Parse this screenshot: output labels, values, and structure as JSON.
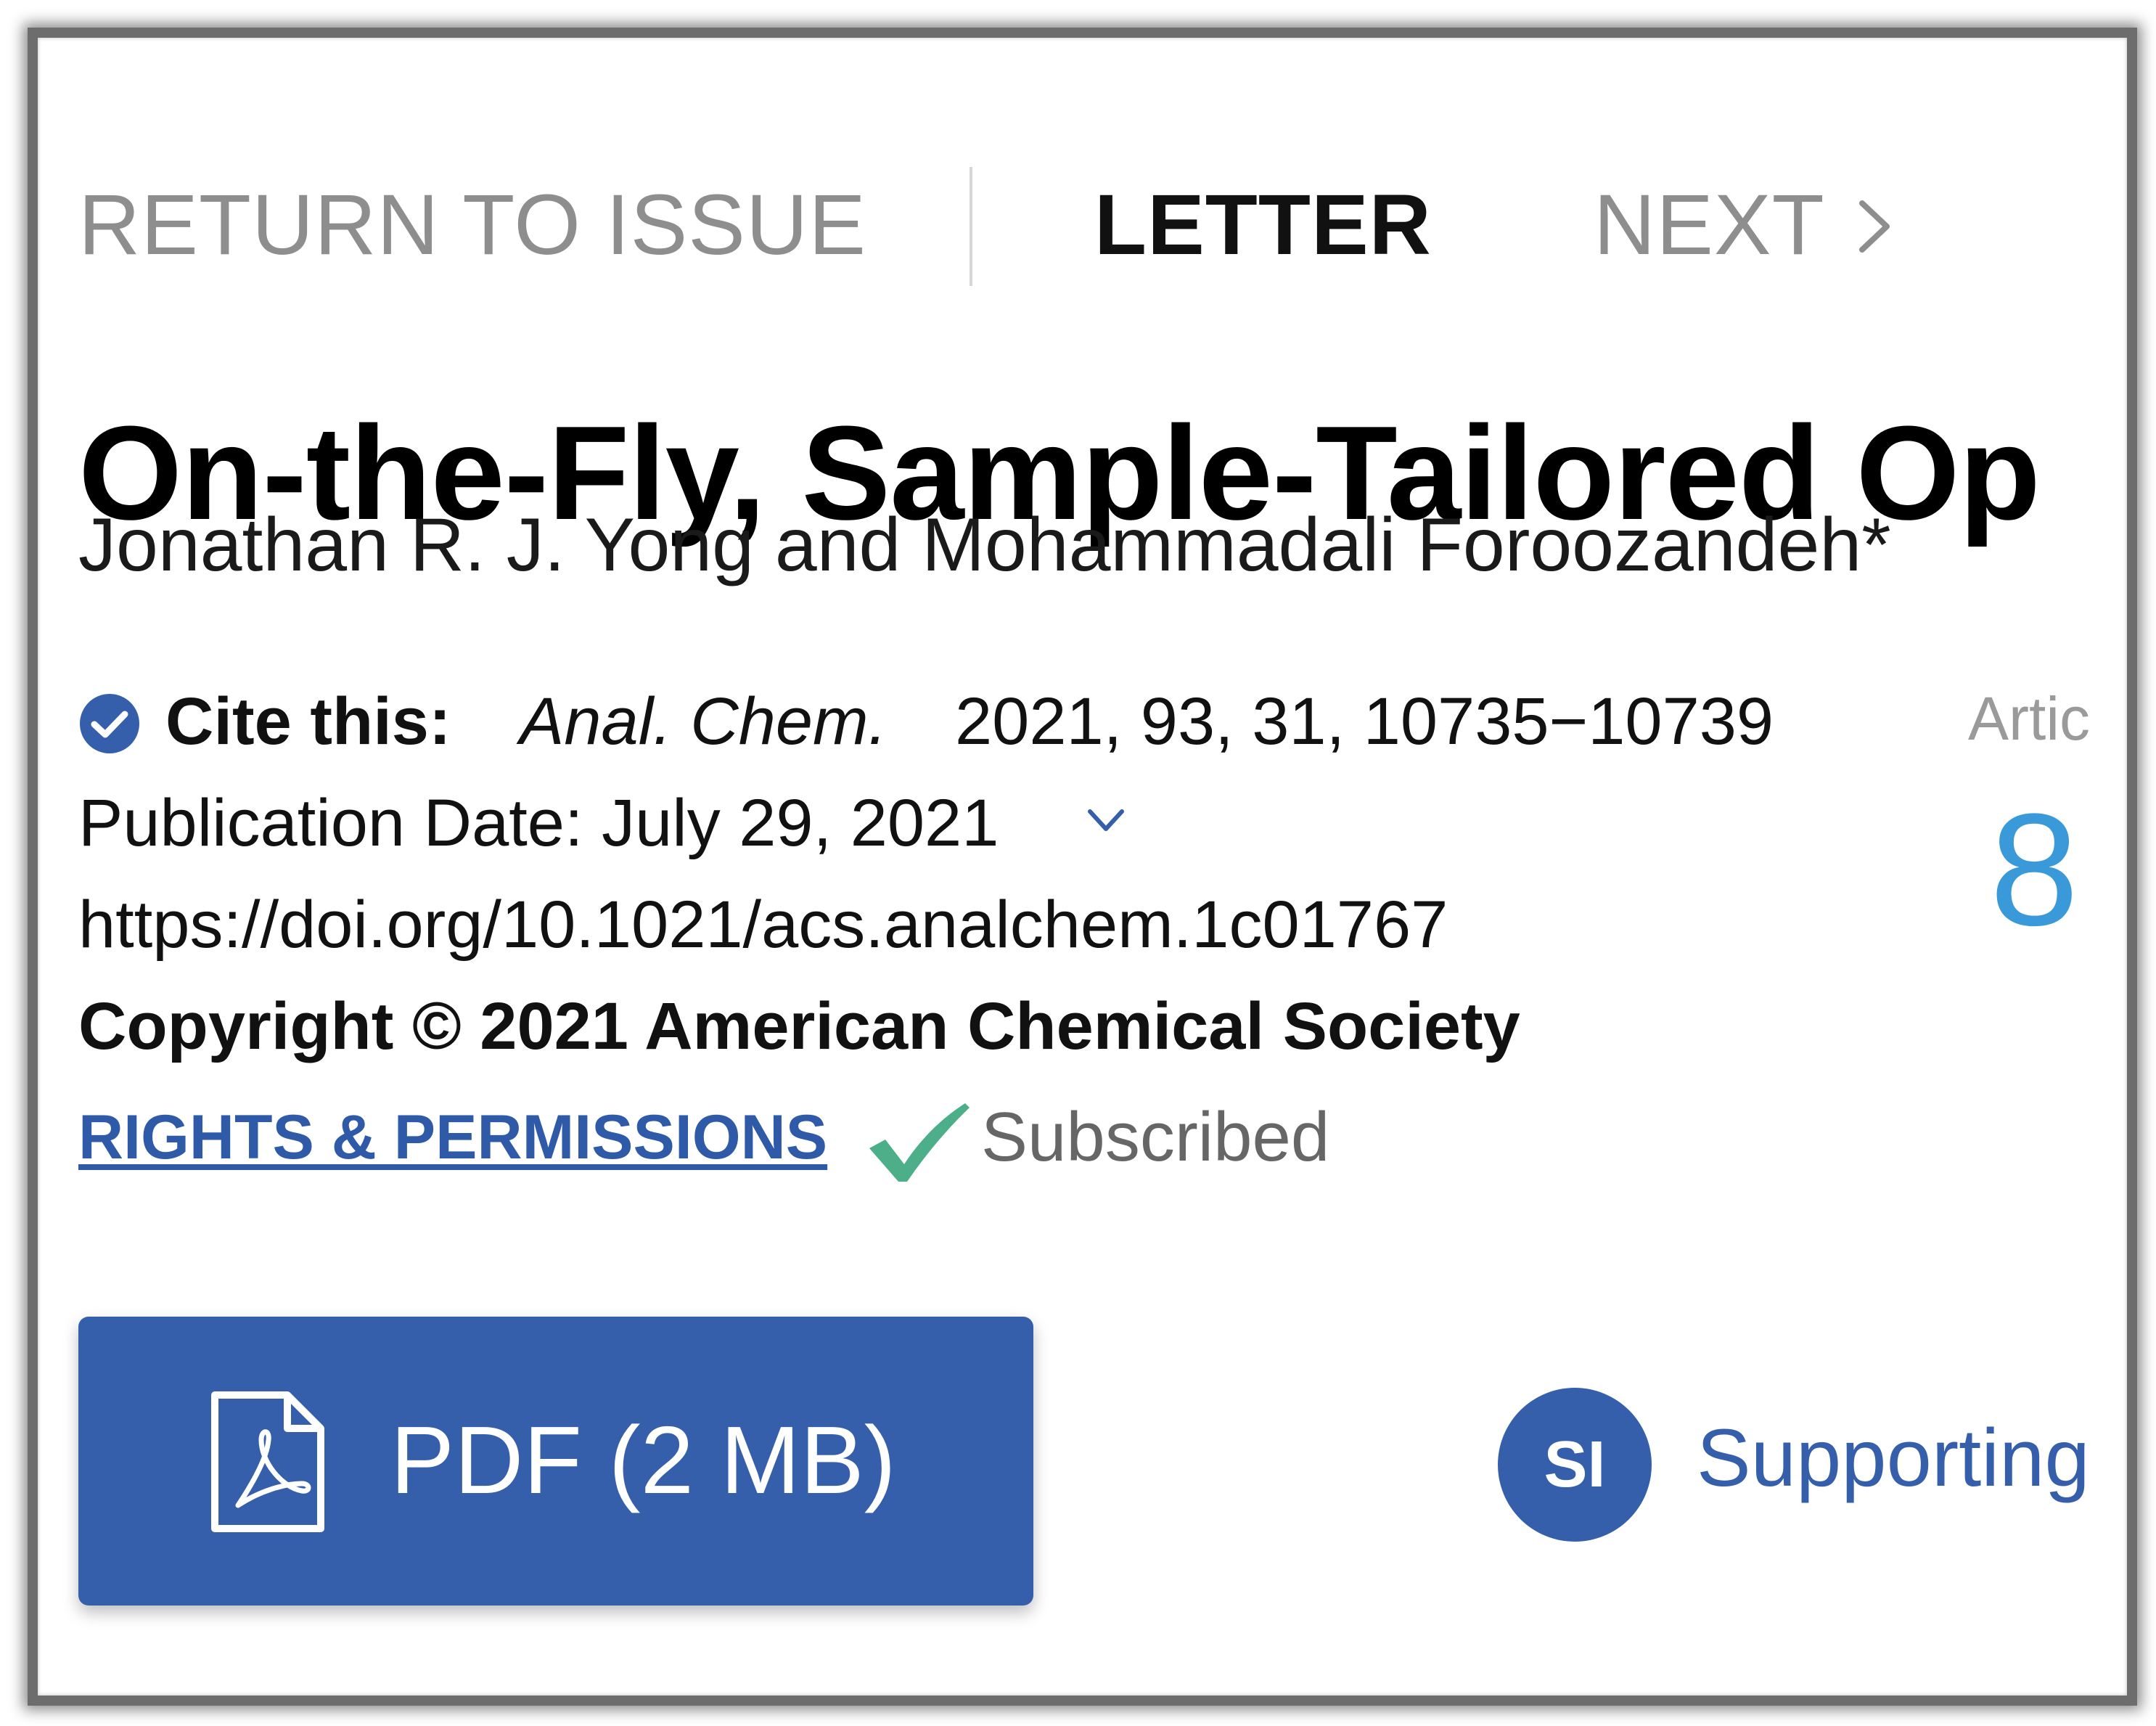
{
  "nav": {
    "return_label": "RETURN TO ISSUE",
    "article_type": "LETTER",
    "next_label": "NEXT",
    "next_icon": "chevron-right-icon"
  },
  "article": {
    "title": "On-the-Fly, Sample-Tailored Op",
    "authors": "Jonathan R. J. Yong and Mohammadali Foroozandeh*",
    "cite_label": "Cite this:",
    "journal": "Anal. Chem.",
    "citation": "2021, 93, 31, 10735−10739",
    "publication_date": "Publication Date: July 29, 2021",
    "doi": "https://doi.org/10.1021/acs.analchem.1c01767",
    "copyright": "Copyright © 2021 American Chemical Society",
    "rights_label": "RIGHTS & PERMISSIONS",
    "access_status": "Subscribed"
  },
  "metrics": {
    "label": "Artic",
    "value": "8"
  },
  "actions": {
    "pdf_label": "PDF (2 MB)",
    "si_badge": "SI",
    "si_label": "Supporting"
  },
  "colors": {
    "accent_blue": "#355fab",
    "metric_blue": "#3a9ad9",
    "subscribed_green": "#4caf8a",
    "muted_gray": "#8e8e8e"
  },
  "icons": {
    "verified": "check-circle-icon",
    "date_toggle": "chevron-down-icon",
    "subscribed": "checkmark-icon",
    "pdf": "pdf-file-icon"
  }
}
